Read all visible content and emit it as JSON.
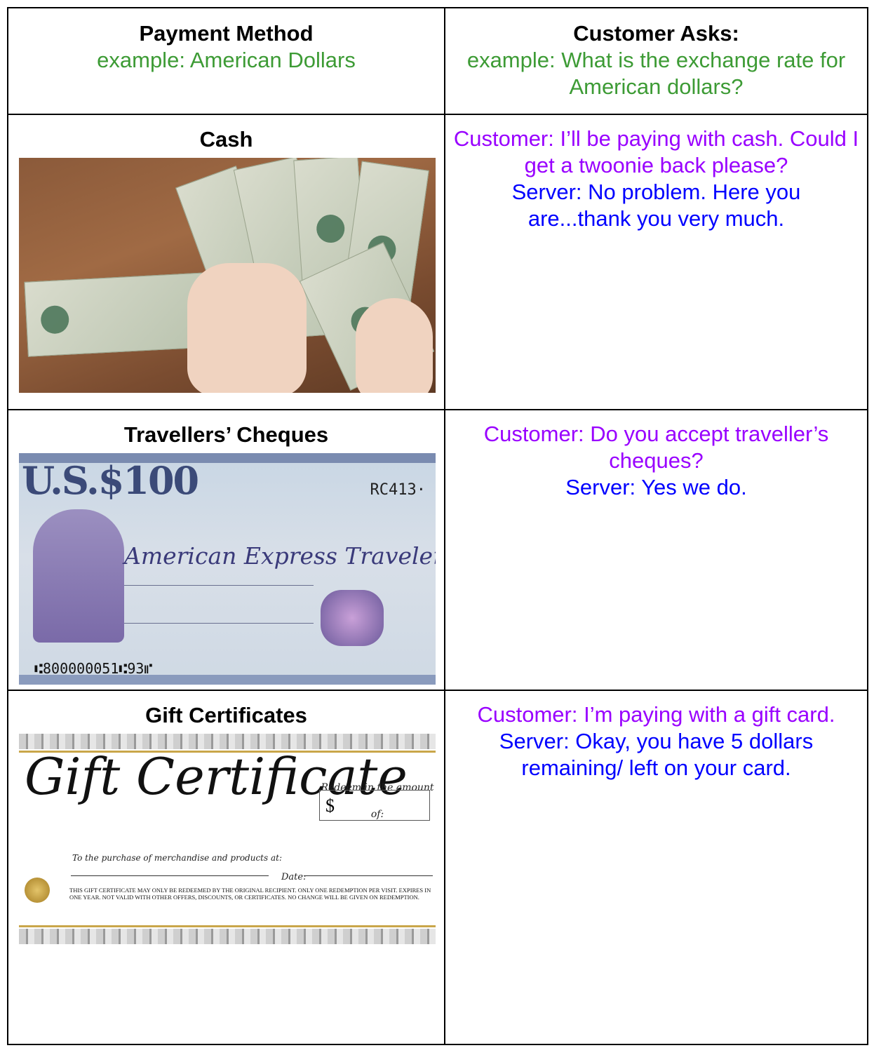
{
  "header": {
    "left_title": "Payment Method",
    "left_example": "example: American Dollars",
    "right_title": "Customer Asks:",
    "right_example": "example: What is the exchange rate for American dollars?"
  },
  "rows": [
    {
      "title": "Cash",
      "customer": "Customer: I’ll be paying with cash. Could I get a twoonie back please?",
      "server": "Server: No problem. Here you are...thank you very much."
    },
    {
      "title": "Travellers’ Cheques",
      "customer": "Customer: Do you accept traveller’s cheques?",
      "server": "Server: Yes we do.",
      "image_text": {
        "amount": "U.S.$100",
        "serial": "RC413·",
        "name": "American Express Travelers Cheque",
        "micr": "⑆800000051⑆93⑈"
      }
    },
    {
      "title": "Gift Certificates",
      "customer": "Customer: I’m paying with a gift card.",
      "server": "Server: Okay, you have 5 dollars remaining/ left on your card.",
      "image_text": {
        "script": "Gift Certificate",
        "redeem": "Redeem in the amount of:",
        "currency": "$",
        "purchase": "To the purchase of merchandise and products at:",
        "date": "Date:",
        "fine_print": "THIS GIFT CERTIFICATE MAY ONLY BE REDEEMED BY THE ORIGINAL RECIPIENT. ONLY ONE REDEMPTION PER VISIT. EXPIRES IN ONE YEAR. NOT VALID WITH OTHER OFFERS, DISCOUNTS, OR CERTIFICATES. NO CHANGE WILL BE GIVEN ON REDEMPTION."
      }
    }
  ],
  "colors": {
    "example": "#3d9b35",
    "customer": "#9900ff",
    "server": "#0000ff"
  }
}
